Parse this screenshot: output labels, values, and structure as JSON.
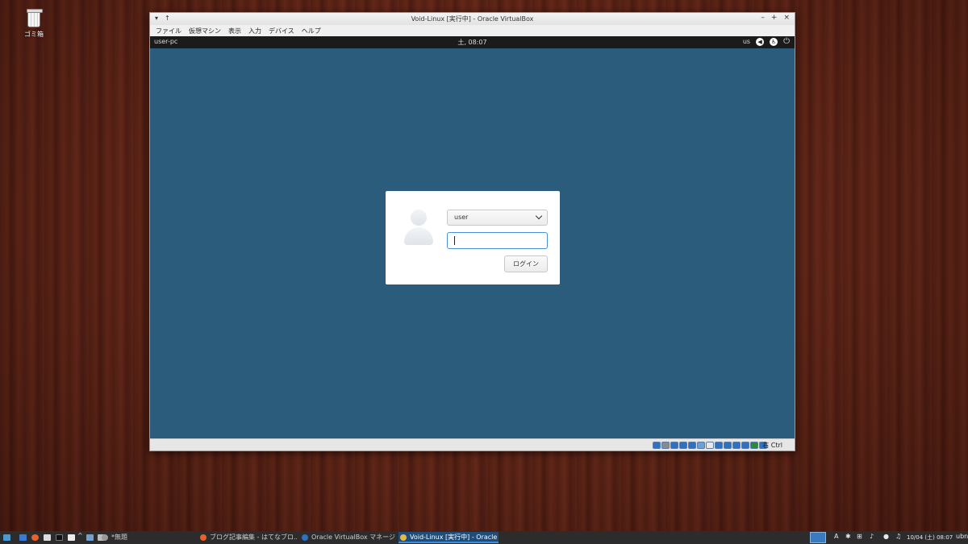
{
  "desktop": {
    "trash_label": "ゴミ箱"
  },
  "vbox": {
    "title": "Void-Linux [実行中] - Oracle VirtualBox",
    "menu": [
      "ファイル",
      "仮想マシン",
      "表示",
      "入力",
      "デバイス",
      "ヘルプ"
    ],
    "host_key": "右 Ctrl",
    "status_icon_colors": [
      "#2f70c0",
      "#8a8a8a",
      "#2f70c0",
      "#2f70c0",
      "#2f70c0",
      "#6aa0d8",
      "#e8e8e8",
      "#2f70c0",
      "#2f70c0",
      "#2f70c0",
      "#2f70c0",
      "#2a8a3a",
      "#2f70c0"
    ]
  },
  "guest": {
    "hostname": "user-pc",
    "clock": "土, 08:07",
    "keyboard": "us",
    "background_color": "#2b5c7c",
    "login": {
      "user": "user",
      "button": "ログイン"
    }
  },
  "taskbar": {
    "tasks": [
      {
        "label": "*無題",
        "icon": "text-editor-icon",
        "color": "#999"
      },
      {
        "label": "ブログ記事編集 - はてなブロ...",
        "icon": "firefox-icon",
        "color": "#e8602a"
      },
      {
        "label": "Oracle VirtualBox マネージ...",
        "icon": "virtualbox-icon",
        "color": "#2f70c0"
      },
      {
        "label": "Void-Linux [実行中] - Oracle ...",
        "icon": "virtualbox-icon",
        "color": "#e6b84a"
      }
    ],
    "datetime": "10/04 (土) 08:07",
    "user": "ubn",
    "keyboard_indicator": "A"
  }
}
